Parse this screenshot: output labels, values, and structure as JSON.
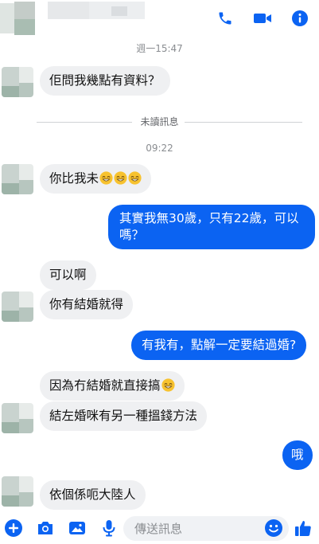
{
  "header": {
    "call_icon": "phone-icon",
    "video_icon": "video-camera-icon",
    "info_icon": "info-icon",
    "accent": "#0b63f2"
  },
  "timeline": {
    "timestamp_1": "週一15:47",
    "unread_label": "未讀訊息",
    "timestamp_2": "09:22"
  },
  "messages": [
    {
      "from": "other",
      "text": "佢問我幾點有資料？"
    },
    {
      "from": "other",
      "text": "你比我未"
    },
    {
      "from": "me",
      "line1": "其實我無30歲，只有22歲，可以",
      "line2": "嗎？"
    },
    {
      "from": "other",
      "text": "可以啊"
    },
    {
      "from": "other",
      "text": "你有結婚就得"
    },
    {
      "from": "me",
      "text": "有我有，點解一定要結過婚?"
    },
    {
      "from": "other",
      "text": "因為冇結婚就直接搞"
    },
    {
      "from": "other",
      "text": "結左婚咪有另一種搵錢方法"
    },
    {
      "from": "me",
      "text": "哦"
    },
    {
      "from": "other",
      "text": "依個係呃大陸人"
    }
  ],
  "composer": {
    "placeholder": "傳送訊息",
    "icons": [
      "plus-icon",
      "camera-icon",
      "image-icon",
      "microphone-icon",
      "emoji-icon",
      "thumbs-up-icon"
    ]
  }
}
